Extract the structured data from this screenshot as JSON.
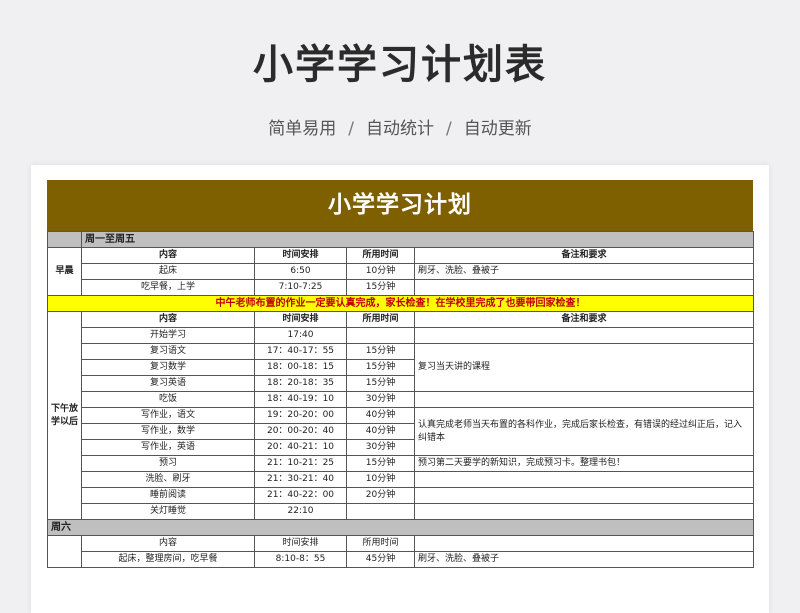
{
  "hero": {
    "title": "小学学习计划表",
    "tags": [
      "简单易用",
      "自动统计",
      "自动更新"
    ],
    "separator": "/"
  },
  "sheet": {
    "banner": "小学学习计划",
    "weekday_section": "周一至周五",
    "columns": [
      "内容",
      "时间安排",
      "所用时间",
      "备注和要求"
    ],
    "morning": {
      "label": "早晨",
      "rows": [
        {
          "content": "起床",
          "time": "6:50",
          "duration": "10分钟",
          "note": "刷牙、洗脸、叠被子"
        },
        {
          "content": "吃早餐，上学",
          "time": "7:10-7:25",
          "duration": "15分钟",
          "note": ""
        }
      ]
    },
    "notice": "中午老师布置的作业一定要认真完成，家长检查！在学校里完成了也要带回家检查！",
    "afternoon": {
      "label": "下午放学以后",
      "rows": [
        {
          "content": "开始学习",
          "time": "17:40",
          "duration": ""
        },
        {
          "content": "复习语文",
          "time": "17：40-17：55",
          "duration": "15分钟"
        },
        {
          "content": "复习数学",
          "time": "18：00-18：15",
          "duration": "15分钟"
        },
        {
          "content": "复习英语",
          "time": "18：20-18：35",
          "duration": "15分钟"
        },
        {
          "content": "吃饭",
          "time": "18：40-19：10",
          "duration": "30分钟"
        },
        {
          "content": "写作业，语文",
          "time": "19：20-20：00",
          "duration": "40分钟"
        },
        {
          "content": "写作业，数学",
          "time": "20：00-20：40",
          "duration": "40分钟"
        },
        {
          "content": "写作业，英语",
          "time": "20：40-21：10",
          "duration": "30分钟"
        },
        {
          "content": "预习",
          "time": "21：10-21：25",
          "duration": "15分钟"
        },
        {
          "content": "洗脸、刷牙",
          "time": "21：30-21：40",
          "duration": "10分钟"
        },
        {
          "content": "睡前阅读",
          "time": "21：40-22：00",
          "duration": "20分钟"
        },
        {
          "content": "关灯睡觉",
          "time": "22:10",
          "duration": ""
        }
      ],
      "notes": {
        "review": "复习当天讲的课程",
        "homework": "认真完成老师当天布置的各科作业，完成后家长检查，有错误的经过纠正后，记入纠错本",
        "preview": "预习第二天要学的新知识，完成预习卡。整理书包！"
      }
    },
    "saturday_section": "周六",
    "saturday": {
      "rows": [
        {
          "content": "起床，整理房间，吃早餐",
          "time": "8:10-8：55",
          "duration": "45分钟",
          "note": "刷牙、洗脸、叠被子"
        }
      ]
    }
  }
}
